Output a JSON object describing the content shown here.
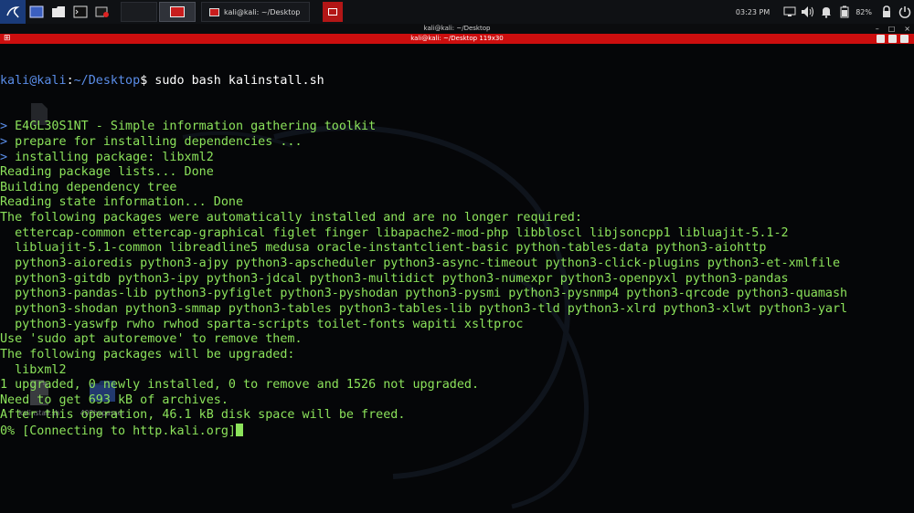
{
  "taskbar": {
    "clock": "03:23 PM",
    "battery": "82%",
    "task_title": "kali@kali: ~/Desktop"
  },
  "window": {
    "title": "kali@kali: ~/Desktop",
    "tab_title": "kali@kali: ~/Desktop 119x30"
  },
  "terminal": {
    "prompt_user": "kali@kali",
    "prompt_sep": ":",
    "prompt_path": "~/Desktop",
    "prompt_symbol": "$",
    "command": " sudo bash kalinstall.sh",
    "lines": [
      "> E4GL30S1NT - Simple information gathering toolkit",
      "> prepare for installing dependencies ...",
      "> installing package: libxml2",
      "Reading package lists... Done",
      "Building dependency tree",
      "Reading state information... Done",
      "The following packages were automatically installed and are no longer required:",
      "  ettercap-common ettercap-graphical figlet finger libapache2-mod-php libbloscl libjsoncpp1 libluajit-5.1-2",
      "  libluajit-5.1-common libreadline5 medusa oracle-instantclient-basic python-tables-data python3-aiohttp",
      "  python3-aioredis python3-ajpy python3-apscheduler python3-async-timeout python3-click-plugins python3-et-xmlfile",
      "  python3-gitdb python3-ipy python3-jdcal python3-multidict python3-numexpr python3-openpyxl python3-pandas",
      "  python3-pandas-lib python3-pyfiglet python3-pyshodan python3-pysmi python3-pysnmp4 python3-qrcode python3-quamash",
      "  python3-shodan python3-smmap python3-tables python3-tables-lib python3-tld python3-xlrd python3-xlwt python3-yarl",
      "  python3-yaswfp rwho rwhod sparta-scripts toilet-fonts wapiti xsltproc",
      "Use 'sudo apt autoremove' to remove them.",
      "The following packages will be upgraded:",
      "  libxml2",
      "1 upgraded, 0 newly installed, 0 to remove and 1526 not upgraded.",
      "Need to get 693 kB of archives.",
      "After this operation, 46.1 kB disk space will be freed.",
      "0% [Connecting to http.kali.org]"
    ]
  },
  "desktop": {
    "icons": [
      {
        "label": "kalinstall.sh",
        "icon": "shell-script-file-icon"
      },
      {
        "label": "403bypasser",
        "icon": "folder-icon"
      }
    ]
  },
  "colors": {
    "terminal_text": "#8ce35b",
    "prompt": "#5a8de8",
    "tab_bar": "#cc0e0e",
    "taskbar": "#0f1114"
  }
}
